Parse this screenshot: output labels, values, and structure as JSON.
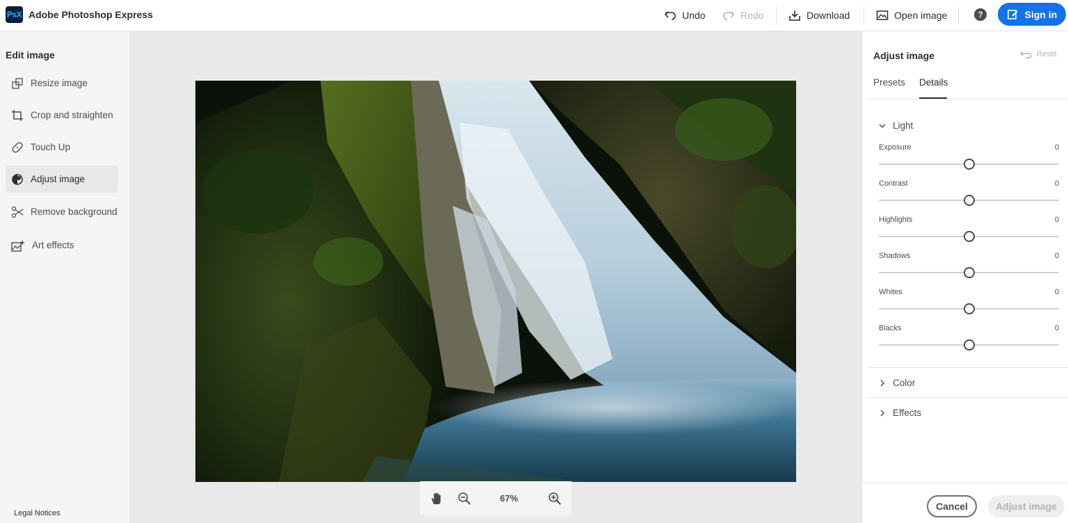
{
  "app": {
    "logo_text": "PsX",
    "title": "Adobe Photoshop Express"
  },
  "toolbar": {
    "undo": "Undo",
    "redo": "Redo",
    "download": "Download",
    "open_image": "Open image",
    "help": "?",
    "sign_in": "Sign in"
  },
  "sidebar": {
    "title": "Edit image",
    "items": [
      {
        "label": "Resize image",
        "icon": "resize-icon"
      },
      {
        "label": "Crop and straighten",
        "icon": "crop-icon"
      },
      {
        "label": "Touch Up",
        "icon": "bandage-icon"
      },
      {
        "label": "Adjust image",
        "icon": "adjust-icon",
        "active": true
      },
      {
        "label": "Remove background",
        "icon": "scissors-icon"
      },
      {
        "label": "Art effects",
        "icon": "art-effects-icon"
      }
    ],
    "legal": "Legal Notices"
  },
  "canvas": {
    "zoom": "67%",
    "image_subject": "waterfall-photo"
  },
  "panel": {
    "title": "Adjust image",
    "reset": "Reset",
    "tabs": [
      {
        "label": "Presets",
        "active": false
      },
      {
        "label": "Details",
        "active": true
      }
    ],
    "light": {
      "label": "Light",
      "expanded": true,
      "sliders": [
        {
          "label": "Exposure",
          "value": "0",
          "level": 0.5
        },
        {
          "label": "Contrast",
          "value": "0",
          "level": 0.5
        },
        {
          "label": "Highlights",
          "value": "0",
          "level": 0.5
        },
        {
          "label": "Shadows",
          "value": "0",
          "level": 0.5
        },
        {
          "label": "Whites",
          "value": "0",
          "level": 0.5
        },
        {
          "label": "Blacks",
          "value": "0",
          "level": 0.5
        }
      ]
    },
    "color": {
      "label": "Color",
      "expanded": false
    },
    "effects": {
      "label": "Effects",
      "expanded": false
    },
    "cancel": "Cancel",
    "apply": "Adjust image"
  },
  "colors": {
    "accent": "#1473e6",
    "logo_bg": "#0a1f3c",
    "logo_text": "#31a8ff"
  }
}
